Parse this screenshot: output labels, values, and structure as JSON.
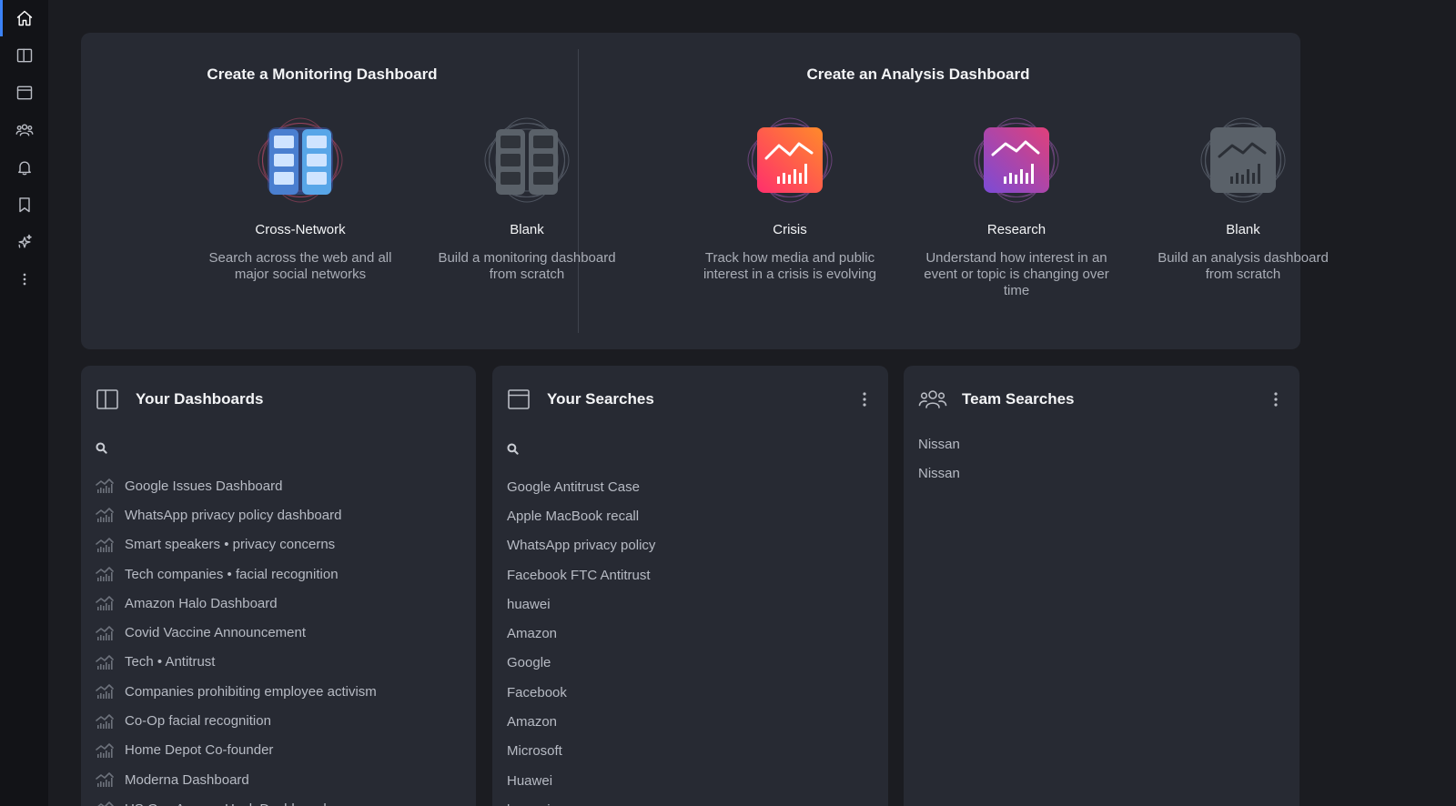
{
  "sidebar": {
    "items": [
      {
        "name": "home",
        "icon": "home-icon",
        "active": true
      },
      {
        "name": "dashboards",
        "icon": "columns-icon"
      },
      {
        "name": "searches",
        "icon": "window-icon"
      },
      {
        "name": "team",
        "icon": "users-icon"
      },
      {
        "name": "alerts",
        "icon": "bell-icon"
      },
      {
        "name": "saved",
        "icon": "bookmark-icon"
      },
      {
        "name": "ai",
        "icon": "sparkle-icon"
      },
      {
        "name": "more",
        "icon": "more-vertical-icon"
      }
    ]
  },
  "create": {
    "monitoring": {
      "title": "Create a Monitoring Dashboard",
      "templates": [
        {
          "name": "Cross-Network",
          "description": "Search across the web and all major social networks",
          "icon": "grid-blue-icon"
        },
        {
          "name": "Blank",
          "description": "Build a monitoring dashboard from scratch",
          "icon": "grid-gray-icon"
        }
      ]
    },
    "analysis": {
      "title": "Create an Analysis Dashboard",
      "templates": [
        {
          "name": "Crisis",
          "description": "Track how media and public interest in a crisis is evolving",
          "icon": "chart-crisis-icon"
        },
        {
          "name": "Research",
          "description": "Understand how interest in an event or topic is changing over time",
          "icon": "chart-research-icon"
        },
        {
          "name": "Blank",
          "description": "Build an analysis dashboard from scratch",
          "icon": "chart-gray-icon"
        }
      ]
    }
  },
  "dashboards": {
    "title": "Your Dashboards",
    "search_placeholder": "",
    "items": [
      "Google Issues Dashboard",
      "WhatsApp privacy policy dashboard",
      "Smart speakers • privacy concerns",
      "Tech companies • facial recognition",
      "Amazon Halo Dashboard",
      "Covid Vaccine Announcement",
      "Tech • Antitrust",
      "Companies prohibiting employee activism",
      "Co-Op facial recognition",
      "Home Depot Co-founder",
      "Moderna Dashboard",
      "US Gov Agency Hack Dashboard"
    ]
  },
  "searches": {
    "title": "Your Searches",
    "search_placeholder": "",
    "items": [
      "Google Antitrust Case",
      "Apple MacBook recall",
      "WhatsApp privacy policy",
      "Facebook FTC Antitrust",
      "huawei",
      "Amazon",
      "Google",
      "Facebook",
      "Amazon",
      "Microsoft",
      "Huawei",
      "huawei"
    ]
  },
  "team": {
    "title": "Team Searches",
    "items": [
      "Nissan",
      "Nissan"
    ]
  },
  "colors": {
    "background": "#1b1c21",
    "panel": "#272a33",
    "rail": "#121317",
    "accent": "#3b82f6",
    "crisis_gradient": [
      "#ff2f6d",
      "#ff8a2a"
    ],
    "research_gradient": [
      "#e0407a",
      "#7b4bd6"
    ],
    "monitor_blue": "#5aa6e6"
  }
}
